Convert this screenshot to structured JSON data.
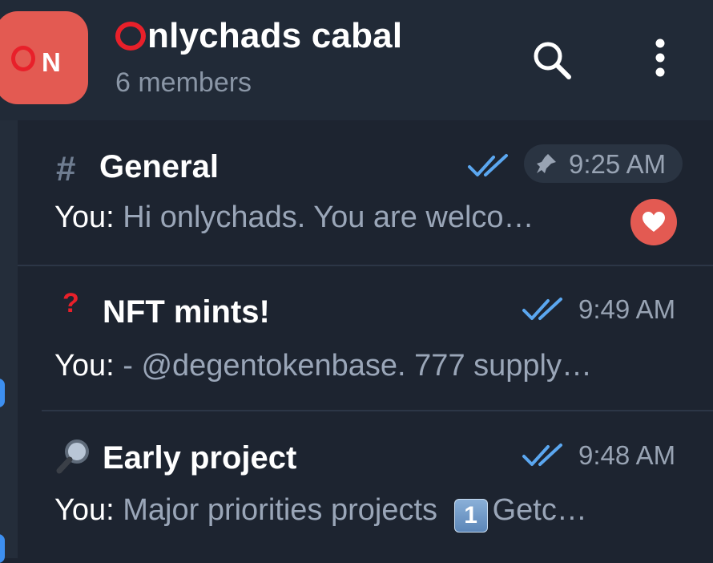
{
  "header": {
    "avatar_initial": "N",
    "avatar_color": "#e35a52",
    "ring_color": "#e8202a",
    "title": "nlychads cabal",
    "subtitle": "6 members",
    "search_icon": "search-icon",
    "menu_icon": "more-vertical-icon"
  },
  "chats": [
    {
      "icon": "hash-icon",
      "icon_text": "#",
      "title": "General",
      "status_icon": "double-check-icon",
      "pinned": true,
      "time": "9:25 AM",
      "preview_sender": "You:",
      "preview_text": " Hi onlychads.   You are welco…",
      "reaction_icon": "heart-icon"
    },
    {
      "icon": "question-mark-icon",
      "icon_text": "?",
      "title": "NFT mints!",
      "status_icon": "double-check-icon",
      "time": "9:49 AM",
      "preview_sender": "You:",
      "preview_text": " - @degentokenbase. 777 supply…"
    },
    {
      "icon": "magnifying-glass-icon",
      "title": "Early project",
      "status_icon": "double-check-icon",
      "time": "9:48 AM",
      "preview_sender": "You:",
      "preview_text_before": " Major priorities projects  ",
      "preview_badge": "1",
      "preview_text_after": "Getc…"
    }
  ],
  "colors": {
    "background": "#1d2430",
    "header": "#212a37",
    "accent_blue": "#3d8ff0",
    "check_blue": "#5ba7f0"
  }
}
